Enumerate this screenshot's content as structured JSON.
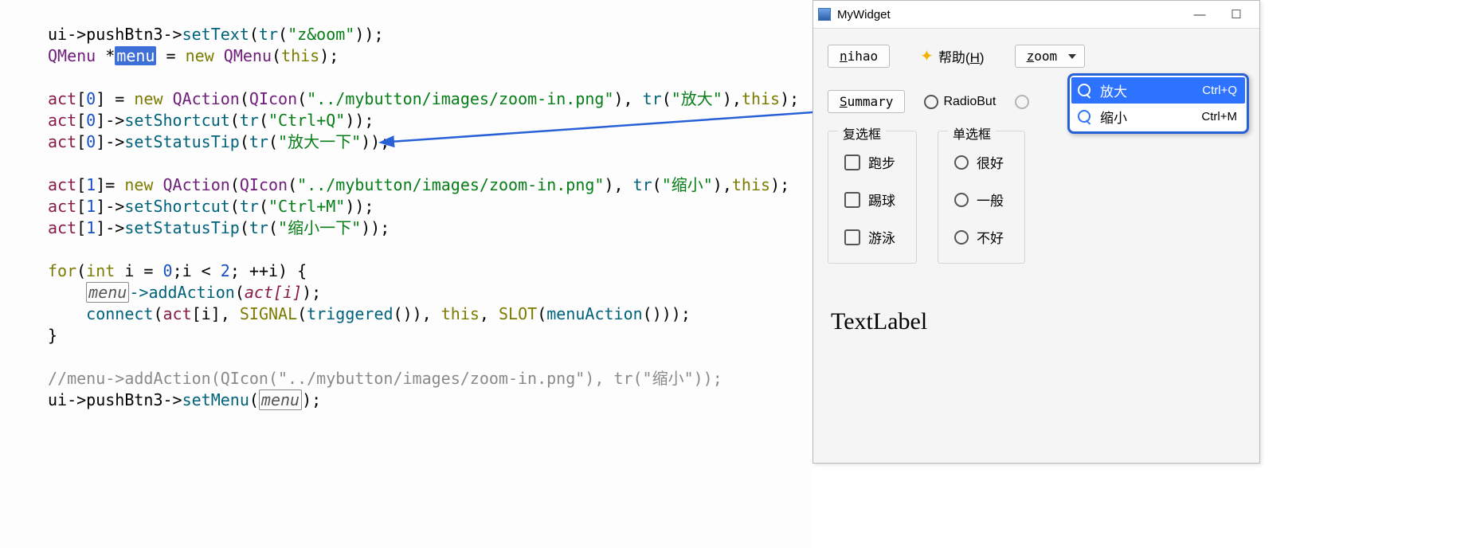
{
  "window": {
    "title": "MyWidget",
    "buttons": {
      "nihao": "nihao",
      "summary": "Summary"
    },
    "help_label": "帮助(H)",
    "zoom_label": "zoom",
    "radio_inline": [
      {
        "label": "RadioBut"
      }
    ],
    "checkbox_group": {
      "title": "复选框",
      "items": [
        "跑步",
        "踢球",
        "游泳"
      ]
    },
    "radio_group": {
      "title": "单选框",
      "items": [
        "很好",
        "一般",
        "不好"
      ]
    },
    "text_label": "TextLabel",
    "menu": [
      {
        "icon": "zoom-in-icon",
        "label": "放大",
        "shortcut": "Ctrl+Q",
        "selected": true
      },
      {
        "icon": "zoom-out-icon",
        "label": "缩小",
        "shortcut": "Ctrl+M",
        "selected": false
      }
    ]
  },
  "code": {
    "l1": {
      "p": "ui->pushBtn3->",
      "f": "setText",
      "a1": "(",
      "f2": "tr",
      "s": "\"z&oom\"",
      "a2": "));"
    },
    "l2": {
      "t": "QMenu",
      "op": " *",
      "sel": "menu",
      "eq": " = ",
      "kw": "new ",
      "t2": "QMenu",
      "a": "(",
      "kw2": "this",
      "a2": ");"
    },
    "l3": {
      "v": "act",
      "idx": "[0]",
      "eq": " = ",
      "kw": "new ",
      "t": "QAction",
      "a": "(",
      "t2": "QIcon",
      "a2": "(",
      "s": "\"../mybutton/images/zoom-in.png\"",
      "a3": "), ",
      "f": "tr",
      "a4": "(",
      "s2": "\"放大\"",
      "a5": "),",
      "kw2": "this",
      "a6": ");"
    },
    "l4": {
      "v": "act",
      "idx": "[0]->",
      "f": "setShortcut",
      "a": "(",
      "f2": "tr",
      "a2": "(",
      "s": "\"Ctrl+Q\"",
      "a3": "));"
    },
    "l5": {
      "v": "act",
      "idx": "[0]->",
      "f": "setStatusTip",
      "a": "(",
      "f2": "tr",
      "a2": "(",
      "s": "\"放大一下\"",
      "a3": "));"
    },
    "l6": {
      "v": "act",
      "idx": "[1]= ",
      "kw": "new ",
      "t": "QAction",
      "a": "(",
      "t2": "QIcon",
      "a2": "(",
      "s": "\"../mybutton/images/zoom-in.png\"",
      "a3": "), ",
      "f": "tr",
      "a4": "(",
      "s2": "\"缩小\"",
      "a5": "),",
      "kw2": "this",
      "a6": ");"
    },
    "l7": {
      "v": "act",
      "idx": "[1]->",
      "f": "setShortcut",
      "a": "(",
      "f2": "tr",
      "a2": "(",
      "s": "\"Ctrl+M\"",
      "a3": "));"
    },
    "l8": {
      "v": "act",
      "idx": "[1]->",
      "f": "setStatusTip",
      "a": "(",
      "f2": "tr",
      "a2": "(",
      "s": "\"缩小一下\"",
      "a3": "));"
    },
    "l9": {
      "kw": "for",
      "a": "(",
      "kw2": "int ",
      "v": "i",
      " eq": " = ",
      "n0": "0",
      "mid": ";i < ",
      "n1": "2",
      "mid2": "; ++i) {"
    },
    "l10": {
      "pad": "    ",
      "box": "menu",
      "f": "->addAction(",
      "v": "act[i]",
      "a2": ");"
    },
    "l11": {
      "pad": "    ",
      "f": "connect",
      "a": "(",
      "v": "act",
      "idx": "[i], ",
      "m": "SIGNAL",
      "a2": "(",
      "f2": "triggered",
      "a3": "()), ",
      "kw": "this",
      ", ": " , ",
      "m2": "SLOT",
      "a4": "(",
      "f3": "menuAction",
      "a5": "()));"
    },
    "l12": {
      "b": "}"
    },
    "l13": {
      "c": "//menu->addAction(QIcon(\"../mybutton/images/zoom-in.png\"), tr(\"缩小\"));"
    },
    "l14": {
      "p": "ui->pushBtn3->",
      "f": "setMenu",
      "a": "(",
      "box": "menu",
      "a2": ");"
    }
  }
}
